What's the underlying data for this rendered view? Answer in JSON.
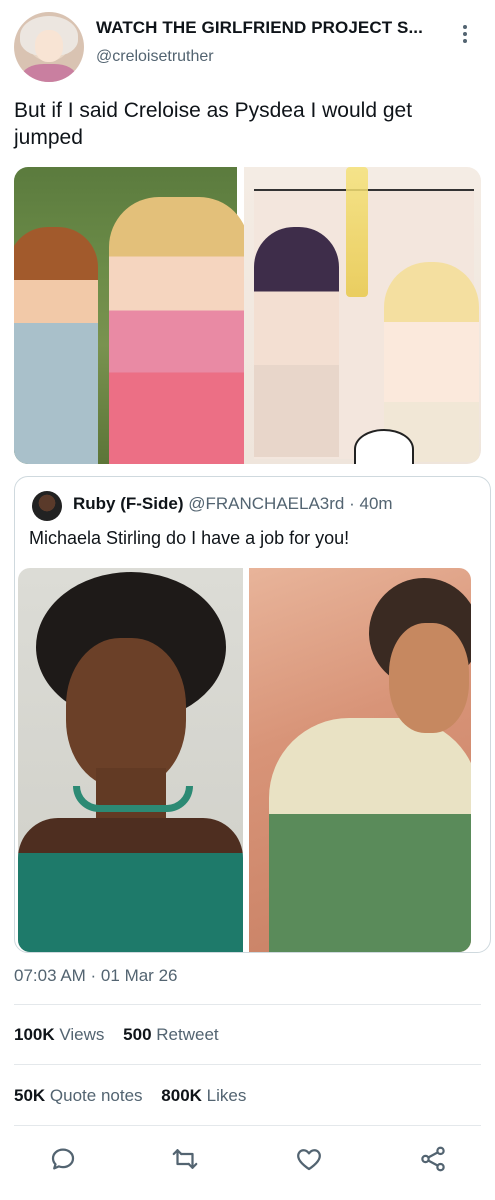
{
  "header": {
    "display_name": "WATCH THE GIRLFRIEND PROJECT S...",
    "handle": "@creloisetruther"
  },
  "tweet": {
    "text": "But if I said Creloise as Pysdea I would get jumped"
  },
  "quote": {
    "name": "Ruby (F-Side)",
    "handle": "@FRANCHAELA3rd",
    "separator": "·",
    "time": "40m",
    "text": "Michaela Stirling do I have a job for you!"
  },
  "meta": {
    "timestamp": "07:03 AM · 01 Mar 26"
  },
  "stats": {
    "views_count": "100K",
    "views_label": "Views",
    "retweets_count": "500",
    "retweets_label": "Retweet",
    "quotes_count": "50K",
    "quotes_label": "Quote notes",
    "likes_count": "800K",
    "likes_label": "Likes"
  },
  "icons": {
    "reply": "reply-icon",
    "retweet": "retweet-icon",
    "like": "heart-icon",
    "share": "share-icon",
    "more": "more-vertical-icon"
  },
  "colors": {
    "text": "#0f1419",
    "secondary": "#536471",
    "border": "#cfd9de"
  }
}
